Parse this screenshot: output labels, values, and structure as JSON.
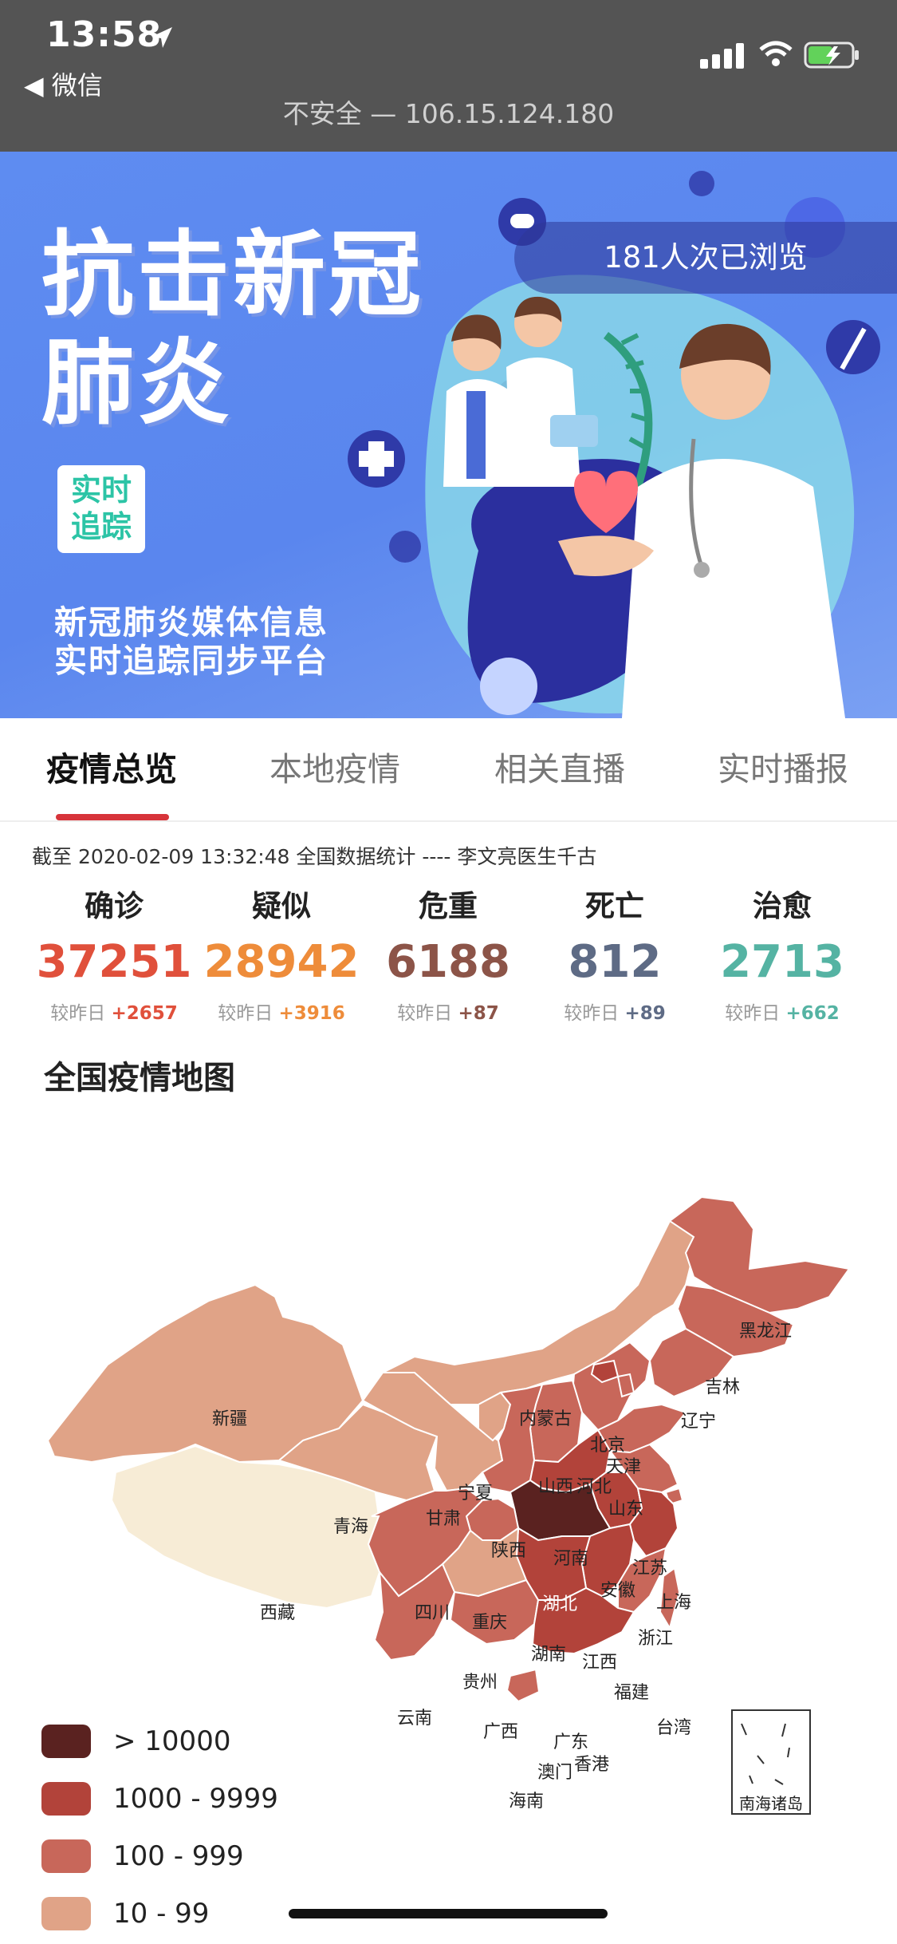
{
  "status_bar": {
    "time": "13:58",
    "back_app": "◀ 微信",
    "url_text": "不安全 — 106.15.124.180"
  },
  "banner": {
    "title_line1": "抗击新冠",
    "title_line2": "肺炎",
    "tag_line1": "实时",
    "tag_line2": "追踪",
    "subtitle_line1": "新冠肺炎媒体信息",
    "subtitle_line2": "实时追踪同步平台",
    "views": "181人次已浏览"
  },
  "tabs": [
    {
      "label": "疫情总览",
      "active": true
    },
    {
      "label": "本地疫情",
      "active": false
    },
    {
      "label": "相关直播",
      "active": false
    },
    {
      "label": "实时播报",
      "active": false
    }
  ],
  "as_of": "截至 2020-02-09 13:32:48 全国数据统计 ---- 李文亮医生千古",
  "stats": [
    {
      "label": "确诊",
      "value": "37251",
      "compare_label": "较昨日",
      "delta": "+2657",
      "color": "#e0503b"
    },
    {
      "label": "疑似",
      "value": "28942",
      "compare_label": "较昨日",
      "delta": "+3916",
      "color": "#ee8c3a"
    },
    {
      "label": "危重",
      "value": "6188",
      "compare_label": "较昨日",
      "delta": "+87",
      "color": "#8c5448"
    },
    {
      "label": "死亡",
      "value": "812",
      "compare_label": "较昨日",
      "delta": "+89",
      "color": "#5e6b85"
    },
    {
      "label": "治愈",
      "value": "2713",
      "compare_label": "较昨日",
      "delta": "+662",
      "color": "#55b3a3"
    }
  ],
  "map": {
    "title": "全国疫情地图",
    "provinces": {
      "xinjiang": "新疆",
      "xizang": "西藏",
      "qinghai": "青海",
      "gansu": "甘肃",
      "neimenggu": "内蒙古",
      "heilongjiang": "黑龙江",
      "jilin": "吉林",
      "liaoning": "辽宁",
      "beijing": "北京",
      "tianjin": "天津",
      "hebei": "河北",
      "shanxi": "山西",
      "shandong": "山东",
      "ningxia": "宁夏",
      "shaanxi": "陕西",
      "henan": "河南",
      "jiangsu": "江苏",
      "anhui": "安徽",
      "shanghai": "上海",
      "hubei": "湖北",
      "sichuan": "四川",
      "chongqing": "重庆",
      "zhejiang": "浙江",
      "hunan": "湖南",
      "jiangxi": "江西",
      "guizhou": "贵州",
      "fujian": "福建",
      "yunnan": "云南",
      "guangxi": "广西",
      "guangdong": "广东",
      "taiwan": "台湾",
      "aomen": "澳门",
      "xianggang": "香港",
      "hainan": "海南",
      "nanhai": "南海诸岛"
    },
    "legend": [
      {
        "label": "> 10000",
        "color": "#5a2220"
      },
      {
        "label": "1000 - 9999",
        "color": "#b2433a"
      },
      {
        "label": "100 - 999",
        "color": "#c8675a"
      },
      {
        "label": "10 - 99",
        "color": "#e0a387"
      }
    ],
    "colors": {
      "lt10": "#f7ecd6",
      "r10": "#e0a387",
      "r100": "#c8675a",
      "r1000": "#b2433a",
      "r10000": "#5a2220"
    }
  }
}
